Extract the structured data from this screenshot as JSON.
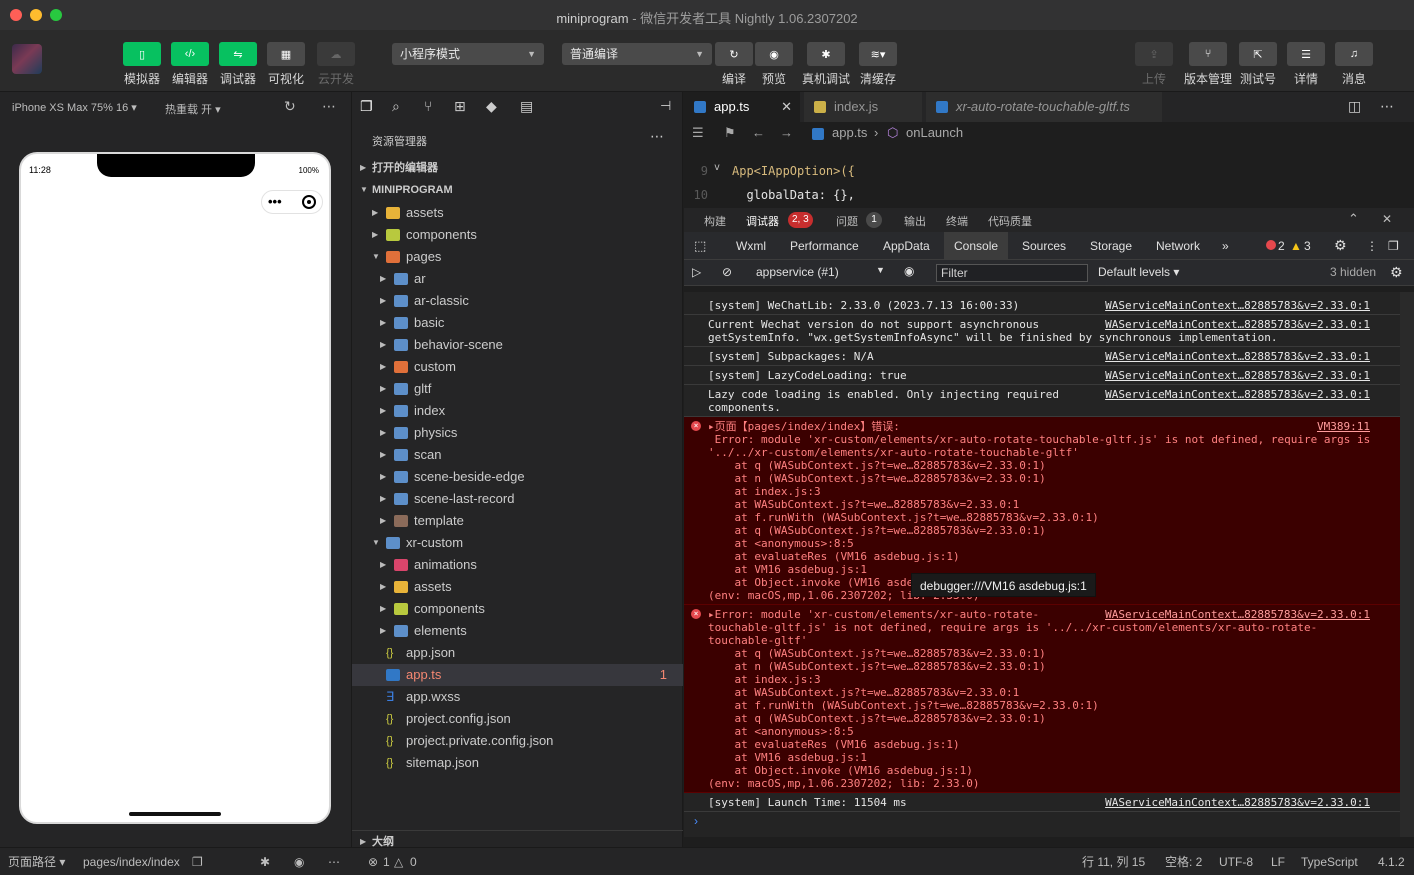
{
  "window": {
    "app_name": "miniprogram",
    "subtitle": "微信开发者工具 Nightly 1.06.2307202"
  },
  "toolbar": {
    "simulator": "模拟器",
    "editor": "编辑器",
    "debugger": "调试器",
    "visual": "可视化",
    "cloud": "云开发",
    "mode": "小程序模式",
    "compile_mode": "普通编译",
    "compile": "编译",
    "preview": "预览",
    "real_debug": "真机调试",
    "clear_cache": "清缓存",
    "upload": "上传",
    "version": "版本管理",
    "test": "测试号",
    "details": "详情",
    "messages": "消息"
  },
  "sim": {
    "device": "iPhone XS Max 75% 16",
    "hot_reload": "热重载 开",
    "time": "11:28",
    "battery": "100%"
  },
  "explorer": {
    "title": "资源管理器",
    "open_editors": "打开的编辑器",
    "project": "MINIPROGRAM",
    "outline": "大纲",
    "tree": [
      {
        "label": "assets",
        "depth": 1,
        "type": "folder",
        "expanded": false
      },
      {
        "label": "components",
        "depth": 1,
        "type": "folder",
        "expanded": false
      },
      {
        "label": "pages",
        "depth": 1,
        "type": "folder",
        "expanded": true
      },
      {
        "label": "ar",
        "depth": 2,
        "type": "folder",
        "expanded": false
      },
      {
        "label": "ar-classic",
        "depth": 2,
        "type": "folder",
        "expanded": false
      },
      {
        "label": "basic",
        "depth": 2,
        "type": "folder",
        "expanded": false
      },
      {
        "label": "behavior-scene",
        "depth": 2,
        "type": "folder",
        "expanded": false
      },
      {
        "label": "custom",
        "depth": 2,
        "type": "folder",
        "expanded": false
      },
      {
        "label": "gltf",
        "depth": 2,
        "type": "folder",
        "expanded": false
      },
      {
        "label": "index",
        "depth": 2,
        "type": "folder",
        "expanded": false
      },
      {
        "label": "physics",
        "depth": 2,
        "type": "folder",
        "expanded": false
      },
      {
        "label": "scan",
        "depth": 2,
        "type": "folder",
        "expanded": false
      },
      {
        "label": "scene-beside-edge",
        "depth": 2,
        "type": "folder",
        "expanded": false
      },
      {
        "label": "scene-last-record",
        "depth": 2,
        "type": "folder",
        "expanded": false
      },
      {
        "label": "template",
        "depth": 2,
        "type": "folder",
        "expanded": false
      },
      {
        "label": "xr-custom",
        "depth": 1,
        "type": "folder",
        "expanded": true
      },
      {
        "label": "animations",
        "depth": 2,
        "type": "folder",
        "expanded": false
      },
      {
        "label": "assets",
        "depth": 2,
        "type": "folder",
        "expanded": false
      },
      {
        "label": "components",
        "depth": 2,
        "type": "folder",
        "expanded": false
      },
      {
        "label": "elements",
        "depth": 2,
        "type": "folder",
        "expanded": false
      },
      {
        "label": "app.json",
        "depth": 1,
        "type": "json"
      },
      {
        "label": "app.ts",
        "depth": 1,
        "type": "ts",
        "badge": "1"
      },
      {
        "label": "app.wxss",
        "depth": 1,
        "type": "css"
      },
      {
        "label": "project.config.json",
        "depth": 1,
        "type": "json"
      },
      {
        "label": "project.private.config.json",
        "depth": 1,
        "type": "json"
      },
      {
        "label": "sitemap.json",
        "depth": 1,
        "type": "json"
      }
    ]
  },
  "editor": {
    "tabs": [
      "app.ts",
      "index.js",
      "xr-auto-rotate-touchable-gltf.ts"
    ],
    "crumb_file": "app.ts",
    "crumb_symbol": "onLaunch",
    "lines": [
      {
        "num": "9",
        "code": "App<IAppOption>({"
      },
      {
        "num": "10",
        "code": "  globalData: {},"
      }
    ]
  },
  "debug": {
    "tabs": [
      "构建",
      "调试器",
      "问题",
      "输出",
      "终端",
      "代码质量"
    ],
    "debugger_badge": "2, 3",
    "problems_badge": "1",
    "devtools_tabs": [
      "Wxml",
      "Performance",
      "AppData",
      "Console",
      "Sources",
      "Storage",
      "Network"
    ],
    "error_count": "2",
    "warn_count": "3",
    "context": "appservice (#1)",
    "filter_placeholder": "Filter",
    "levels": "Default levels",
    "hidden": "3 hidden",
    "tooltip": "debugger:///VM16 asdebug.js:1"
  },
  "console": [
    {
      "text": "[system] WeChatLib: 2.33.0 (2023.7.13 16:00:33)",
      "src": "WAServiceMainContext…82885783&v=2.33.0:1"
    },
    {
      "text": "Current Wechat version do not support asynchronous\ngetSystemInfo. \"wx.getSystemInfoAsync\" will be finished by synchronous implementation.",
      "src": "WAServiceMainContext…82885783&v=2.33.0:1"
    },
    {
      "text": "[system] Subpackages: N/A",
      "src": "WAServiceMainContext…82885783&v=2.33.0:1"
    },
    {
      "text": "[system] LazyCodeLoading: true",
      "src": "WAServiceMainContext…82885783&v=2.33.0:1"
    },
    {
      "text": "Lazy code loading is enabled. Only injecting required\ncomponents.",
      "src": "WAServiceMainContext…82885783&v=2.33.0:1"
    },
    {
      "text": "▸页面【pages/index/index】错误:\n Error: module 'xr-custom/elements/xr-auto-rotate-touchable-gltf.js' is not defined, require args is\n'../../xr-custom/elements/xr-auto-rotate-touchable-gltf'\n    at q (WASubContext.js?t=we…82885783&v=2.33.0:1)\n    at n (WASubContext.js?t=we…82885783&v=2.33.0:1)\n    at index.js:3\n    at WASubContext.js?t=we…82885783&v=2.33.0:1\n    at f.runWith (WASubContext.js?t=we…82885783&v=2.33.0:1)\n    at q (WASubContext.js?t=we…82885783&v=2.33.0:1)\n    at <anonymous>:8:5\n    at evaluateRes (VM16 asdebug.js:1)\n    at VM16 asdebug.js:1\n    at Object.invoke (VM16 asde\n(env: macOS,mp,1.06.2307202; lib: 2.33.0)",
      "src": "VM389:11",
      "error": true
    },
    {
      "text": "▸Error: module 'xr-custom/elements/xr-auto-rotate-\ntouchable-gltf.js' is not defined, require args is '../../xr-custom/elements/xr-auto-rotate-\ntouchable-gltf'\n    at q (WASubContext.js?t=we…82885783&v=2.33.0:1)\n    at n (WASubContext.js?t=we…82885783&v=2.33.0:1)\n    at index.js:3\n    at WASubContext.js?t=we…82885783&v=2.33.0:1\n    at f.runWith (WASubContext.js?t=we…82885783&v=2.33.0:1)\n    at q (WASubContext.js?t=we…82885783&v=2.33.0:1)\n    at <anonymous>:8:5\n    at evaluateRes (VM16 asdebug.js:1)\n    at VM16 asdebug.js:1\n    at Object.invoke (VM16 asdebug.js:1)\n(env: macOS,mp,1.06.2307202; lib: 2.33.0)",
      "src": "WAServiceMainContext…82885783&v=2.33.0:1",
      "error": true
    },
    {
      "text": "[system] Launch Time: 11504 ms",
      "src": "WAServiceMainContext…82885783&v=2.33.0:1"
    }
  ],
  "status": {
    "page_path_label": "页面路径",
    "page_path": "pages/index/index",
    "errors": "1",
    "warnings": "0",
    "position": "行 11, 列 15",
    "spaces": "空格: 2",
    "encoding": "UTF-8",
    "eol": "LF",
    "language": "TypeScript",
    "version": "4.1.2"
  },
  "colors": {
    "accent_green": "#07c160",
    "error_bg": "#3b0000",
    "error_text": "#ff8080"
  }
}
